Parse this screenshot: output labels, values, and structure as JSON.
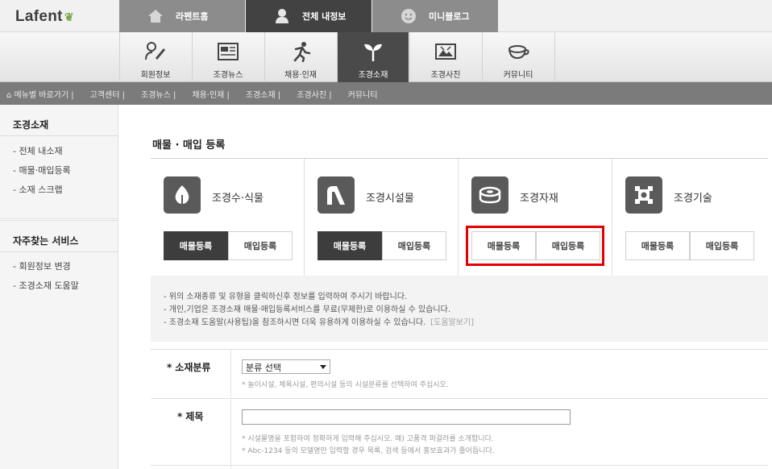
{
  "brand": {
    "logo": "Lafent",
    "leaf": "❦"
  },
  "global_tabs": [
    {
      "label": "라펜트홈",
      "icon": "home-icon"
    },
    {
      "label": "전체 내정보",
      "icon": "person-icon"
    },
    {
      "label": "미니블로그",
      "icon": "smiley-icon"
    }
  ],
  "main_menu": [
    {
      "label": "회원정보",
      "icon": "member-icon"
    },
    {
      "label": "조경뉴스",
      "icon": "newspaper-icon"
    },
    {
      "label": "채용·인재",
      "icon": "runner-icon"
    },
    {
      "label": "조경소재",
      "icon": "sprout-icon"
    },
    {
      "label": "조경사진",
      "icon": "photo-icon"
    },
    {
      "label": "커뮤니티",
      "icon": "cup-icon"
    }
  ],
  "sub_nav": [
    "⌂ 메뉴별 바로가기 |",
    "고객센터 |",
    "조경뉴스 |",
    "채용·인재 |",
    "조경소재 |",
    "조경사진 |",
    "커뮤니티"
  ],
  "sidebar": {
    "section1_title": "조경소재",
    "section1_items": [
      "- 전체 내소재",
      "- 매물·매입등록",
      "- 소재 스크랩"
    ],
    "section2_title": "자주찾는 서비스",
    "section2_items": [
      "- 회원정보 변경",
      "- 조경소재 도움말"
    ]
  },
  "page_title": "매물 · 매입 등록",
  "categories": [
    {
      "name": "조경수·식물",
      "icon": "leaf-icon",
      "sell": "매물등록",
      "buy": "매입등록",
      "sell_active": true
    },
    {
      "name": "조경시설물",
      "icon": "slide-icon",
      "sell": "매물등록",
      "buy": "매입등록",
      "sell_active": true
    },
    {
      "name": "조경자재",
      "icon": "material-icon",
      "sell": "매물등록",
      "buy": "매입등록",
      "sell_active": false
    },
    {
      "name": "조경기술",
      "icon": "gear-icon",
      "sell": "매물등록",
      "buy": "매입등록",
      "sell_active": false
    }
  ],
  "notice": {
    "line1": "- 위의 소재종류 및 유형을 클릭하신후 정보를 입력하여 주시기 바랍니다.",
    "line2": "- 개인,기업은 조경소재 매물·매입등록서비스를 무료(무제한)로 이용하실 수 있습니다.",
    "line3": "- 조경소재 도움말(사용팁)을 참조하시면 더욱 유용하게 이용하실 수 있습니다.",
    "help_link": "[도움말보기]"
  },
  "form": {
    "category_label": "소재분류",
    "category_required": "*",
    "category_select": "분류 선택",
    "category_hint": "* 놀이시설, 체육시설, 편의시설 등의 시설분류를 선택하여 주십시오.",
    "title_label": "제목",
    "title_required": "*",
    "title_value": "",
    "title_hint1": "* 시설물명을 포함하여 정확하게 입력해 주십시오. 예) 고품격 퍼걸러를 소개합니다.",
    "title_hint2": "* Abc-1234 등의 모델명만 입력할 경우 목록, 검색 등에서 홍보효과가 줄어듭니다."
  },
  "colors": {
    "highlight": "#e30000",
    "active_tab": "#424242",
    "accent_leaf": "#7ca64a"
  }
}
